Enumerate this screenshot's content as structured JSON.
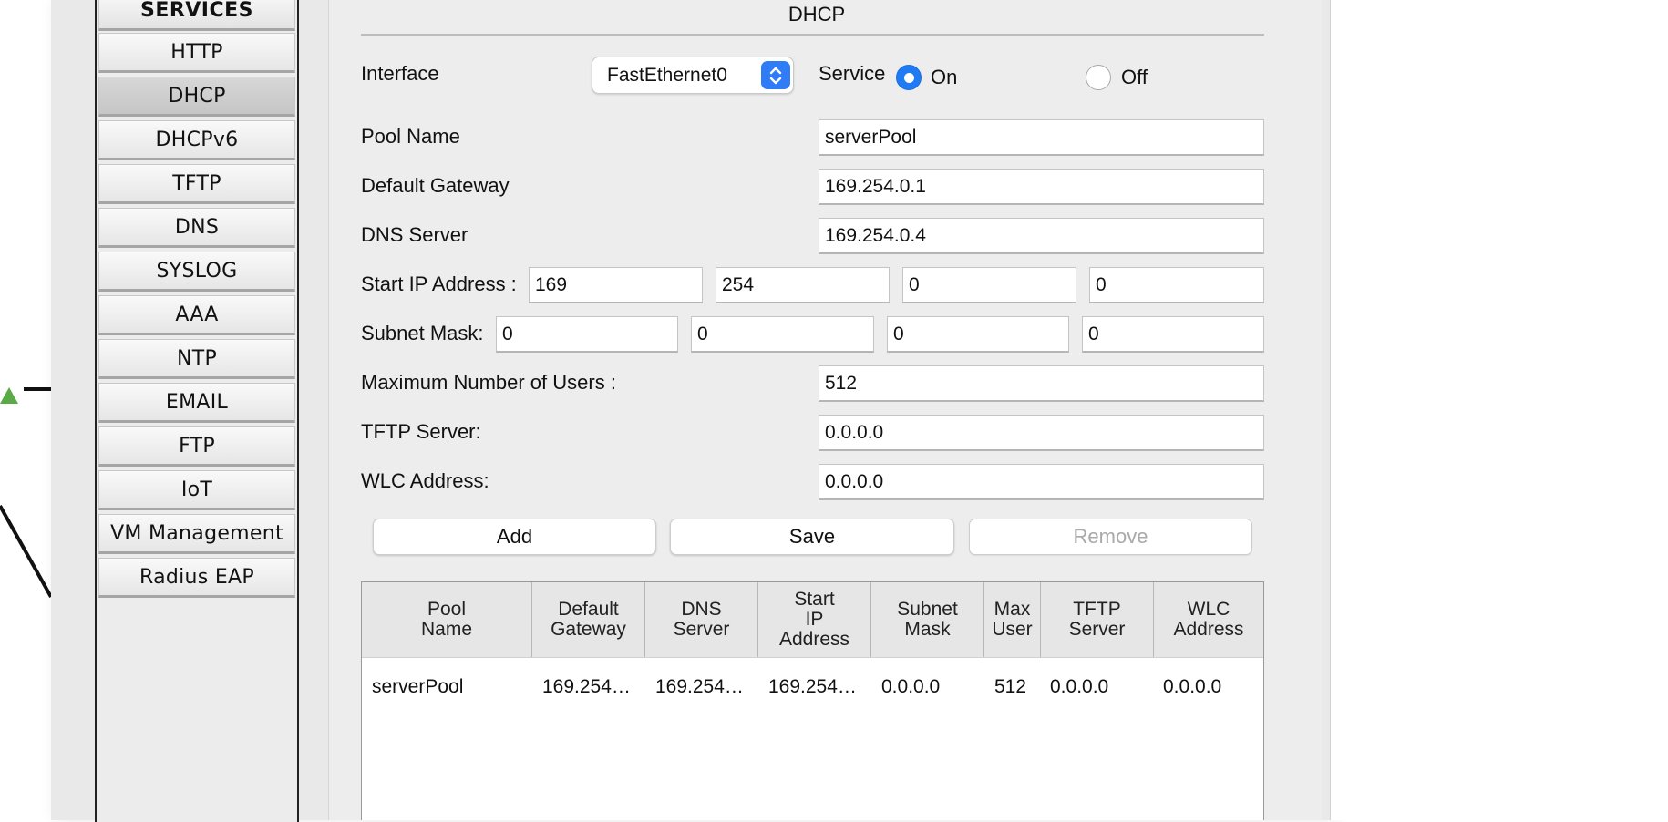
{
  "sidebar": {
    "header": "SERVICES",
    "items": [
      {
        "label": "HTTP",
        "selected": false
      },
      {
        "label": "DHCP",
        "selected": true
      },
      {
        "label": "DHCPv6",
        "selected": false
      },
      {
        "label": "TFTP",
        "selected": false
      },
      {
        "label": "DNS",
        "selected": false
      },
      {
        "label": "SYSLOG",
        "selected": false
      },
      {
        "label": "AAA",
        "selected": false
      },
      {
        "label": "NTP",
        "selected": false
      },
      {
        "label": "EMAIL",
        "selected": false
      },
      {
        "label": "FTP",
        "selected": false
      },
      {
        "label": "IoT",
        "selected": false
      },
      {
        "label": "VM Management",
        "selected": false
      },
      {
        "label": "Radius EAP",
        "selected": false
      }
    ]
  },
  "panel": {
    "title": "DHCP",
    "interface_label": "Interface",
    "interface_value": "FastEthernet0",
    "service_label": "Service",
    "service_on_label": "On",
    "service_off_label": "Off",
    "service_state": "On",
    "pool_name_label": "Pool Name",
    "pool_name_value": "serverPool",
    "default_gateway_label": "Default Gateway",
    "default_gateway_value": "169.254.0.1",
    "dns_server_label": "DNS Server",
    "dns_server_value": "169.254.0.4",
    "start_ip_label": "Start IP Address :",
    "start_ip_octets": [
      "169",
      "254",
      "0",
      "0"
    ],
    "subnet_mask_label": "Subnet Mask:",
    "subnet_mask_octets": [
      "0",
      "0",
      "0",
      "0"
    ],
    "max_users_label": "Maximum Number of Users :",
    "max_users_value": "512",
    "tftp_server_label": "TFTP Server:",
    "tftp_server_value": "0.0.0.0",
    "wlc_address_label": "WLC Address:",
    "wlc_address_value": "0.0.0.0",
    "add_label": "Add",
    "save_label": "Save",
    "remove_label": "Remove"
  },
  "pool_table": {
    "headers": [
      "Pool\nName",
      "Default\nGateway",
      "DNS\nServer",
      "Start\nIP\nAddress",
      "Subnet\nMask",
      "Max\nUser",
      "TFTP\nServer",
      "WLC\nAddress"
    ],
    "rows": [
      [
        "serverPool",
        "169.254…",
        "169.254…",
        "169.254…",
        "0.0.0.0",
        "512",
        "0.0.0.0",
        "0.0.0.0"
      ]
    ]
  },
  "colors": {
    "accent": "#1f7bf3",
    "topology_node": "#5aaa45"
  },
  "icons": [
    "stepper-updown-icon",
    "radio-selected-icon",
    "radio-unselected-icon",
    "triangle-node-icon"
  ]
}
